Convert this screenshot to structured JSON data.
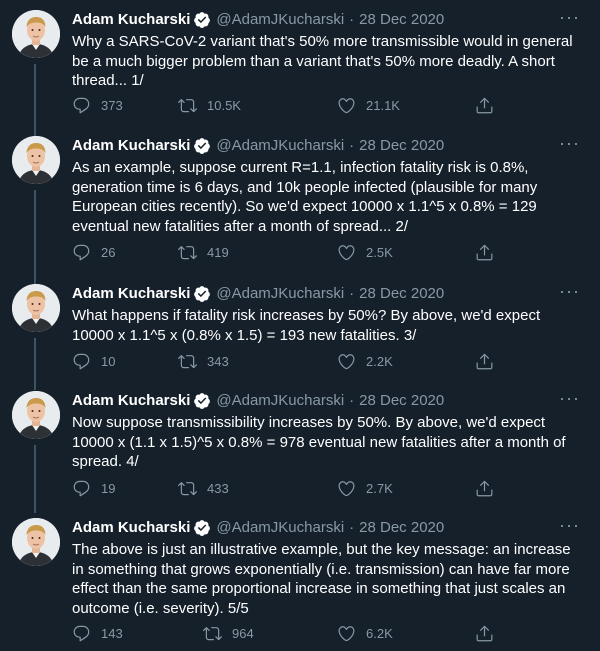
{
  "author": {
    "name": "Adam Kucharski",
    "handle": "@AdamJKucharski",
    "separator": "·",
    "more_label": "···"
  },
  "colors": {
    "background": "#15202b",
    "text": "#ffffff",
    "secondary": "#8899a6",
    "verified": "#ffffff",
    "thread_line": "#3d5466"
  },
  "icons": {
    "reply": "reply-icon",
    "retweet": "retweet-icon",
    "like": "like-icon",
    "share": "share-icon",
    "verified": "verified-badge-icon",
    "more": "more-icon"
  },
  "tweets": [
    {
      "date": "28 Dec 2020",
      "text": "Why a SARS-CoV-2 variant that's 50% more transmissible would in general be a much bigger problem than a variant that's 50% more deadly. A short thread... 1/",
      "replies": "373",
      "retweets": "10.5K",
      "likes": "21.1K"
    },
    {
      "date": "28 Dec 2020",
      "text": "As an example, suppose current R=1.1, infection fatality risk is 0.8%, generation time is 6 days, and 10k people infected (plausible for many European cities recently). So we'd expect 10000 x 1.1^5 x 0.8% = 129 eventual new fatalities after a month of spread... 2/",
      "replies": "26",
      "retweets": "419",
      "likes": "2.5K"
    },
    {
      "date": "28 Dec 2020",
      "text": "What happens if fatality risk increases by 50%? By above, we'd expect 10000 x 1.1^5 x (0.8% x 1.5) = 193 new fatalities. 3/",
      "replies": "10",
      "retweets": "343",
      "likes": "2.2K"
    },
    {
      "date": "28 Dec 2020",
      "text": "Now suppose transmissibility increases by 50%. By above, we'd expect 10000 x (1.1 x 1.5)^5 x 0.8% = 978 eventual new fatalities after a month of spread. 4/",
      "replies": "19",
      "retweets": "433",
      "likes": "2.7K"
    },
    {
      "date": "28 Dec 2020",
      "text": "The above is just an illustrative example, but the key message: an increase in something that grows exponentially (i.e. transmission) can have far more effect than the same proportional increase in something that just scales an outcome (i.e. severity). 5/5",
      "replies": "143",
      "retweets": "964",
      "likes": "6.2K"
    }
  ]
}
